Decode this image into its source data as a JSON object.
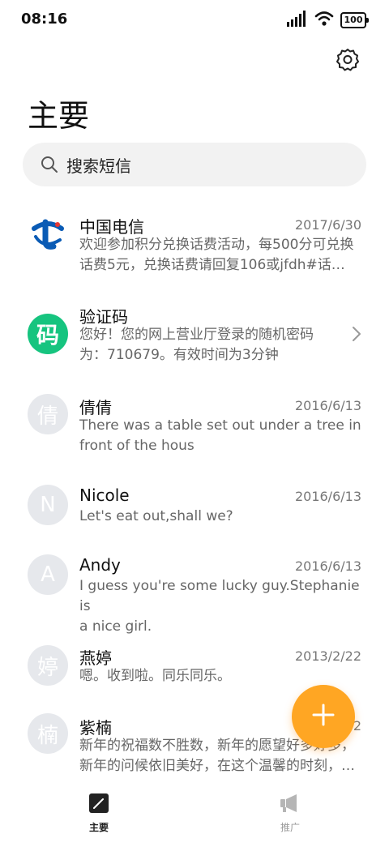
{
  "status_bar": {
    "time": "08:16",
    "battery": "100"
  },
  "page": {
    "title": "主要"
  },
  "search": {
    "placeholder": "搜索短信"
  },
  "messages": [
    {
      "sender": "中国电信",
      "date": "2017/6/30",
      "preview_line1": "欢迎参加积分兑换话费活动，每500分可兑换",
      "preview_line2": "话费5元，兑换话费请回复106或jfdh#话…",
      "avatar_text": "",
      "avatar_icon": "china-telecom-logo"
    },
    {
      "sender": "验证码",
      "date": "",
      "preview_line1": "您好！您的网上营业厅登录的随机密码",
      "preview_line2": "为：710679。有效时间为3分钟",
      "avatar_text": "码"
    },
    {
      "sender": "倩倩",
      "date": "2016/6/13",
      "preview_line1": "There was a table set out under a tree in",
      "preview_line2": "front of the hous",
      "avatar_text": "倩"
    },
    {
      "sender": "Nicole",
      "date": "2016/6/13",
      "preview_line1": "Let's eat out,shall we?",
      "preview_line2": "",
      "avatar_text": "N"
    },
    {
      "sender": "Andy",
      "date": "2016/6/13",
      "preview_line1": "I guess you're some lucky guy.Stephanie is",
      "preview_line2": "a nice girl.",
      "avatar_text": "A"
    },
    {
      "sender": "燕婷",
      "date": "2013/2/22",
      "preview_line1": "嗯。收到啦。同乐同乐。",
      "preview_line2": "",
      "avatar_text": "婷"
    },
    {
      "sender": "紫楠",
      "date": "2",
      "preview_line1": "新年的祝福数不胜数，新年的愿望好多好多，",
      "preview_line2": "新年的问候依旧美好，在这个温馨的时刻，…",
      "avatar_text": "楠"
    }
  ],
  "bottom_nav": {
    "main_label": "主要",
    "promo_label": "推广"
  },
  "colors": {
    "fab": "#ffa623",
    "verify_avatar": "#16c47f",
    "telecom_blue": "#0a5bb5"
  }
}
